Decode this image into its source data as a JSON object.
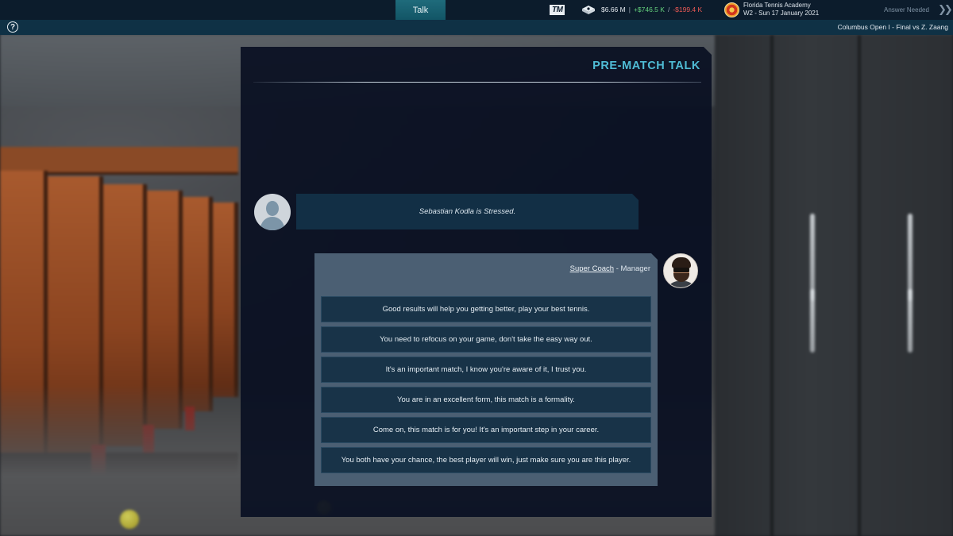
{
  "topbar": {
    "tab_talk": "Talk",
    "logo_text": "TM",
    "finance": {
      "balance": "$6.66 M",
      "separator": "|",
      "income": "+$746.5 K",
      "slash": "/",
      "expenses": "-$199.4 K",
      "positive_color": "#64d17d",
      "negative_color": "#ee5a55"
    },
    "academy_name": "Florida Tennis Academy",
    "date": "W2 - Sun 17 January 2021",
    "answer_needed": "Answer Needed",
    "next_icon": "double-chevron-right-icon"
  },
  "subbar": {
    "help_glyph": "?",
    "match_info": "Columbus Open I - Final vs Z. Zaang"
  },
  "panel": {
    "title": "PRE-MATCH TALK",
    "accent_color": "#4fbcd5"
  },
  "player_message": {
    "avatar_icon": "person-silhouette-icon",
    "text": "Sebastian Kodla is Stressed."
  },
  "coach": {
    "name": "Super Coach",
    "role": " - Manager",
    "options": [
      "Good results will help you getting better, play your best tennis.",
      "You need to refocus on your game, don't take the easy way out.",
      "It's an important match, I know you're aware of it, I trust you.",
      "You are in an excellent form, this match is a formality.",
      "Come on, this match is for you! It's an important step in your career.",
      "You both have your chance, the best player will win, just make sure you are this player."
    ]
  }
}
